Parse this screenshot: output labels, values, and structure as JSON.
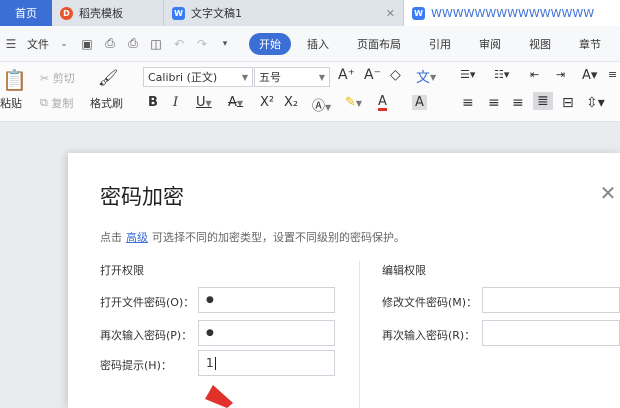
{
  "tabs": [
    {
      "label": "首页"
    },
    {
      "label": "稻壳模板"
    },
    {
      "label": "文字文稿1"
    },
    {
      "label": "WWWWWWWWWWWWWWW"
    }
  ],
  "menu": {
    "file": "文件",
    "start": "开始",
    "items": [
      "插入",
      "页面布局",
      "引用",
      "审阅",
      "视图",
      "章节"
    ]
  },
  "ribbon": {
    "paste": "粘贴",
    "cut": "剪切",
    "copy": "复制",
    "format_painter": "格式刷",
    "font_name": "Calibri (正文)",
    "font_size": "五号",
    "bold": "B",
    "italic": "I",
    "underline": "U",
    "strike": "A",
    "superscript": "X²",
    "subscript": "X₂",
    "grow": "A⁺",
    "shrink": "A⁻",
    "font_color": "A",
    "wen": "文"
  },
  "dialog": {
    "title": "密码加密",
    "desc_prefix": "点击",
    "desc_link": "高级",
    "desc_suffix": "可选择不同的加密类型，设置不同级别的密码保护。",
    "open_section": "打开权限",
    "edit_section": "编辑权限",
    "open_password_label": "打开文件密码(O)：",
    "open_password_value": "●",
    "open_confirm_label": "再次输入密码(P)：",
    "open_confirm_value": "●",
    "hint_label": "密码提示(H)：",
    "hint_value": "1",
    "edit_password_label": "修改文件密码(M)：",
    "edit_password_value": "",
    "edit_confirm_label": "再次输入密码(R)：",
    "edit_confirm_value": ""
  },
  "colors": {
    "accent": "#3b6fd6",
    "pointer": "#e0312b"
  }
}
